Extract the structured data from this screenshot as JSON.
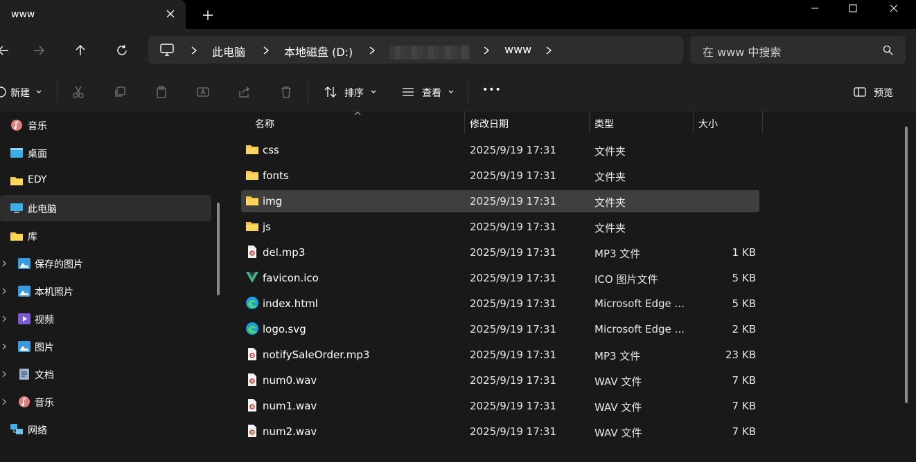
{
  "window": {
    "tab_title": "www",
    "search_placeholder": "在 www 中搜索"
  },
  "breadcrumb": [
    "此电脑",
    "本地磁盘 (D:)",
    "www"
  ],
  "toolbar": {
    "new_label": "新建",
    "sort_label": "排序",
    "view_label": "查看",
    "more_label": "•••",
    "preview_label": "预览"
  },
  "sidebar": {
    "items": [
      {
        "label": "音乐",
        "icon": "music-icon"
      },
      {
        "label": "桌面",
        "icon": "desktop-icon"
      },
      {
        "label": "EDY",
        "icon": "folder-icon"
      },
      {
        "label": "此电脑",
        "icon": "computer-icon",
        "selected": true
      },
      {
        "label": "库",
        "icon": "folder-icon"
      },
      {
        "label": "保存的图片",
        "icon": "pictures-icon"
      },
      {
        "label": "本机照片",
        "icon": "pictures-icon"
      },
      {
        "label": "视频",
        "icon": "video-icon"
      },
      {
        "label": "图片",
        "icon": "pictures-icon"
      },
      {
        "label": "文档",
        "icon": "document-icon"
      },
      {
        "label": "音乐",
        "icon": "music-icon"
      },
      {
        "label": "网络",
        "icon": "network-icon"
      }
    ]
  },
  "columns": {
    "name": "名称",
    "date": "修改日期",
    "type": "类型",
    "size": "大小"
  },
  "files": [
    {
      "name": "css",
      "date": "2025/9/19 17:31",
      "type": "文件夹",
      "size": "",
      "icon": "folder-icon"
    },
    {
      "name": "fonts",
      "date": "2025/9/19 17:31",
      "type": "文件夹",
      "size": "",
      "icon": "folder-icon"
    },
    {
      "name": "img",
      "date": "2025/9/19 17:31",
      "type": "文件夹",
      "size": "",
      "icon": "folder-icon",
      "selected": true
    },
    {
      "name": "js",
      "date": "2025/9/19 17:31",
      "type": "文件夹",
      "size": "",
      "icon": "folder-icon"
    },
    {
      "name": "del.mp3",
      "date": "2025/9/19 17:31",
      "type": "MP3 文件",
      "size": "1 KB",
      "icon": "audio-file-icon"
    },
    {
      "name": "favicon.ico",
      "date": "2025/9/19 17:31",
      "type": "ICO 图片文件",
      "size": "5 KB",
      "icon": "vue-icon"
    },
    {
      "name": "index.html",
      "date": "2025/9/19 17:31",
      "type": "Microsoft Edge ...",
      "size": "5 KB",
      "icon": "edge-icon"
    },
    {
      "name": "logo.svg",
      "date": "2025/9/19 17:31",
      "type": "Microsoft Edge ...",
      "size": "2 KB",
      "icon": "edge-icon"
    },
    {
      "name": "notifySaleOrder.mp3",
      "date": "2025/9/19 17:31",
      "type": "MP3 文件",
      "size": "23 KB",
      "icon": "audio-file-icon"
    },
    {
      "name": "num0.wav",
      "date": "2025/9/19 17:31",
      "type": "WAV 文件",
      "size": "7 KB",
      "icon": "audio-file-icon"
    },
    {
      "name": "num1.wav",
      "date": "2025/9/19 17:31",
      "type": "WAV 文件",
      "size": "7 KB",
      "icon": "audio-file-icon"
    },
    {
      "name": "num2.wav",
      "date": "2025/9/19 17:31",
      "type": "WAV 文件",
      "size": "7 KB",
      "icon": "audio-file-icon"
    }
  ],
  "colors": {
    "background": "#191919",
    "titlebar": "#000000",
    "panel": "#202020",
    "field": "#2d2d2d",
    "folder": "#f5c543",
    "selected_row": "#3f3f3f"
  }
}
